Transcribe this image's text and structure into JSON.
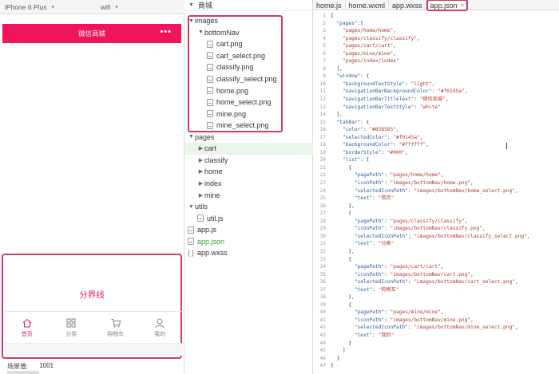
{
  "simulator": {
    "device": "iPhone 6 Plus",
    "network": "wifi",
    "nav_title": "微信商城",
    "nav_dots": "•••",
    "divider_text": "分界线",
    "tabs": [
      {
        "label": "首页",
        "icon": "home-icon",
        "active": true
      },
      {
        "label": "分类",
        "icon": "grid-icon",
        "active": false
      },
      {
        "label": "购物车",
        "icon": "cart-icon",
        "active": false
      },
      {
        "label": "我的",
        "icon": "user-icon",
        "active": false
      }
    ],
    "scene_label": "场景值:",
    "scene_value": "1001"
  },
  "tree": {
    "root": "商城",
    "items": [
      {
        "label": "images",
        "kind": "folder",
        "open": true,
        "depth": 0
      },
      {
        "label": "bottomNav",
        "kind": "folder",
        "open": true,
        "depth": 1
      },
      {
        "label": "cart.png",
        "kind": "file",
        "depth": 2
      },
      {
        "label": "cart_select.png",
        "kind": "file",
        "depth": 2
      },
      {
        "label": "classify.png",
        "kind": "file",
        "depth": 2
      },
      {
        "label": "classify_select.png",
        "kind": "file",
        "depth": 2
      },
      {
        "label": "home.png",
        "kind": "file",
        "depth": 2
      },
      {
        "label": "home_select.png",
        "kind": "file",
        "depth": 2
      },
      {
        "label": "mine.png",
        "kind": "file",
        "depth": 2
      },
      {
        "label": "mine_select.png",
        "kind": "file",
        "depth": 2
      },
      {
        "label": "pages",
        "kind": "folder",
        "open": true,
        "depth": 0
      },
      {
        "label": "cart",
        "kind": "folder",
        "open": false,
        "depth": 1
      },
      {
        "label": "classify",
        "kind": "folder",
        "open": false,
        "depth": 1
      },
      {
        "label": "home",
        "kind": "folder",
        "open": false,
        "depth": 1
      },
      {
        "label": "index",
        "kind": "folder",
        "open": false,
        "depth": 1
      },
      {
        "label": "mine",
        "kind": "folder",
        "open": false,
        "depth": 1
      },
      {
        "label": "utils",
        "kind": "folder",
        "open": true,
        "depth": 0
      },
      {
        "label": "util.js",
        "kind": "file",
        "depth": 1
      },
      {
        "label": "app.js",
        "kind": "file",
        "depth": 0
      },
      {
        "label": "app.json",
        "kind": "file",
        "depth": 0,
        "green": true
      },
      {
        "label": "app.wxss",
        "kind": "brace",
        "depth": 0
      }
    ]
  },
  "editor": {
    "tabs": [
      {
        "label": "home.js",
        "active": false
      },
      {
        "label": "home.wxml",
        "active": false
      },
      {
        "label": "app.wxss",
        "active": false
      },
      {
        "label": "app.json",
        "active": true
      }
    ],
    "close_glyph": "×",
    "lines": [
      "{",
      "  \"pages\":[",
      "    \"pages/home/home\",",
      "    \"pages/classify/classify\",",
      "    \"pages/cart/cart\",",
      "    \"pages/mine/mine\",",
      "    \"pages/index/index\"",
      "  ],",
      "  \"window\": {",
      "    \"backgroundTextStyle\": \"light\",",
      "    \"navigationBarBackgroundColor\": \"#f0145a\",",
      "    \"navigationBarTitleText\": \"微信商城\",",
      "    \"navigationBarTextStyle\": \"white\"",
      "  },",
      "  \"tabBar\": {",
      "    \"color\": \"#858585\",",
      "    \"selectedColor\": \"#f0145a\",",
      "    \"backgroundColor\": \"#ffffff\",",
      "    \"borderStyle\": \"#000\",",
      "    \"list\": [",
      "      {",
      "        \"pagePath\": \"pages/home/home\",",
      "        \"iconPath\": \"images/bottomNav/home.png\",",
      "        \"selectedIconPath\": \"images/bottomNav/home_select.png\",",
      "        \"text\": \"首页\"",
      "      },",
      "      {",
      "        \"pagePath\": \"pages/classify/classify\",",
      "        \"iconPath\": \"images/bottomNav/classify.png\",",
      "        \"selectedIconPath\": \"images/bottomNav/classify_select.png\",",
      "        \"text\": \"分类\"",
      "      },",
      "      {",
      "        \"pagePath\": \"pages/cart/cart\",",
      "        \"iconPath\": \"images/bottomNav/cart.png\",",
      "        \"selectedIconPath\": \"images/bottomNav/cart_select.png\",",
      "        \"text\": \"购物车\"",
      "      },",
      "      {",
      "        \"pagePath\": \"pages/mine/mine\",",
      "        \"iconPath\": \"images/bottomNav/mine.png\",",
      "        \"selectedIconPath\": \"images/bottomNav/mine_select.png\",",
      "        \"text\": \"我的\"",
      "      }",
      "    ]",
      "  }",
      "}"
    ]
  },
  "colors": {
    "accent": "#f0145a",
    "highlight_border": "#d23a5a",
    "tab_inactive": "#858585"
  }
}
